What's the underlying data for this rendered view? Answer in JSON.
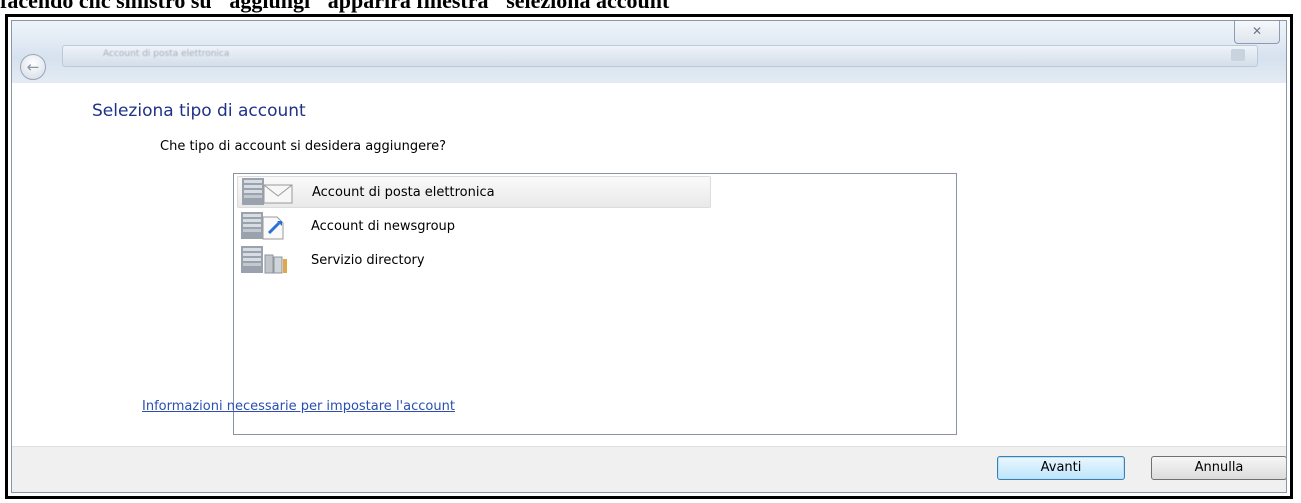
{
  "caption": "facendo clic sinistro su \"aggiungi\" apparirà finestra \"seleziona account\"",
  "window": {
    "close_glyph": "✕",
    "back_glyph": "←",
    "address_text": "Account di posta elettronica"
  },
  "page": {
    "heading": "Seleziona tipo di account",
    "question": "Che tipo di account si desidera aggiungere?"
  },
  "account_types": [
    {
      "label": "Account di posta elettronica",
      "icon": "mail-account-icon",
      "selected": true
    },
    {
      "label": "Account di newsgroup",
      "icon": "newsgroup-account-icon",
      "selected": false
    },
    {
      "label": "Servizio directory",
      "icon": "directory-service-icon",
      "selected": false
    }
  ],
  "help_link": "Informazioni necessarie per impostare l'account",
  "buttons": {
    "next": "Avanti",
    "cancel": "Annulla"
  }
}
